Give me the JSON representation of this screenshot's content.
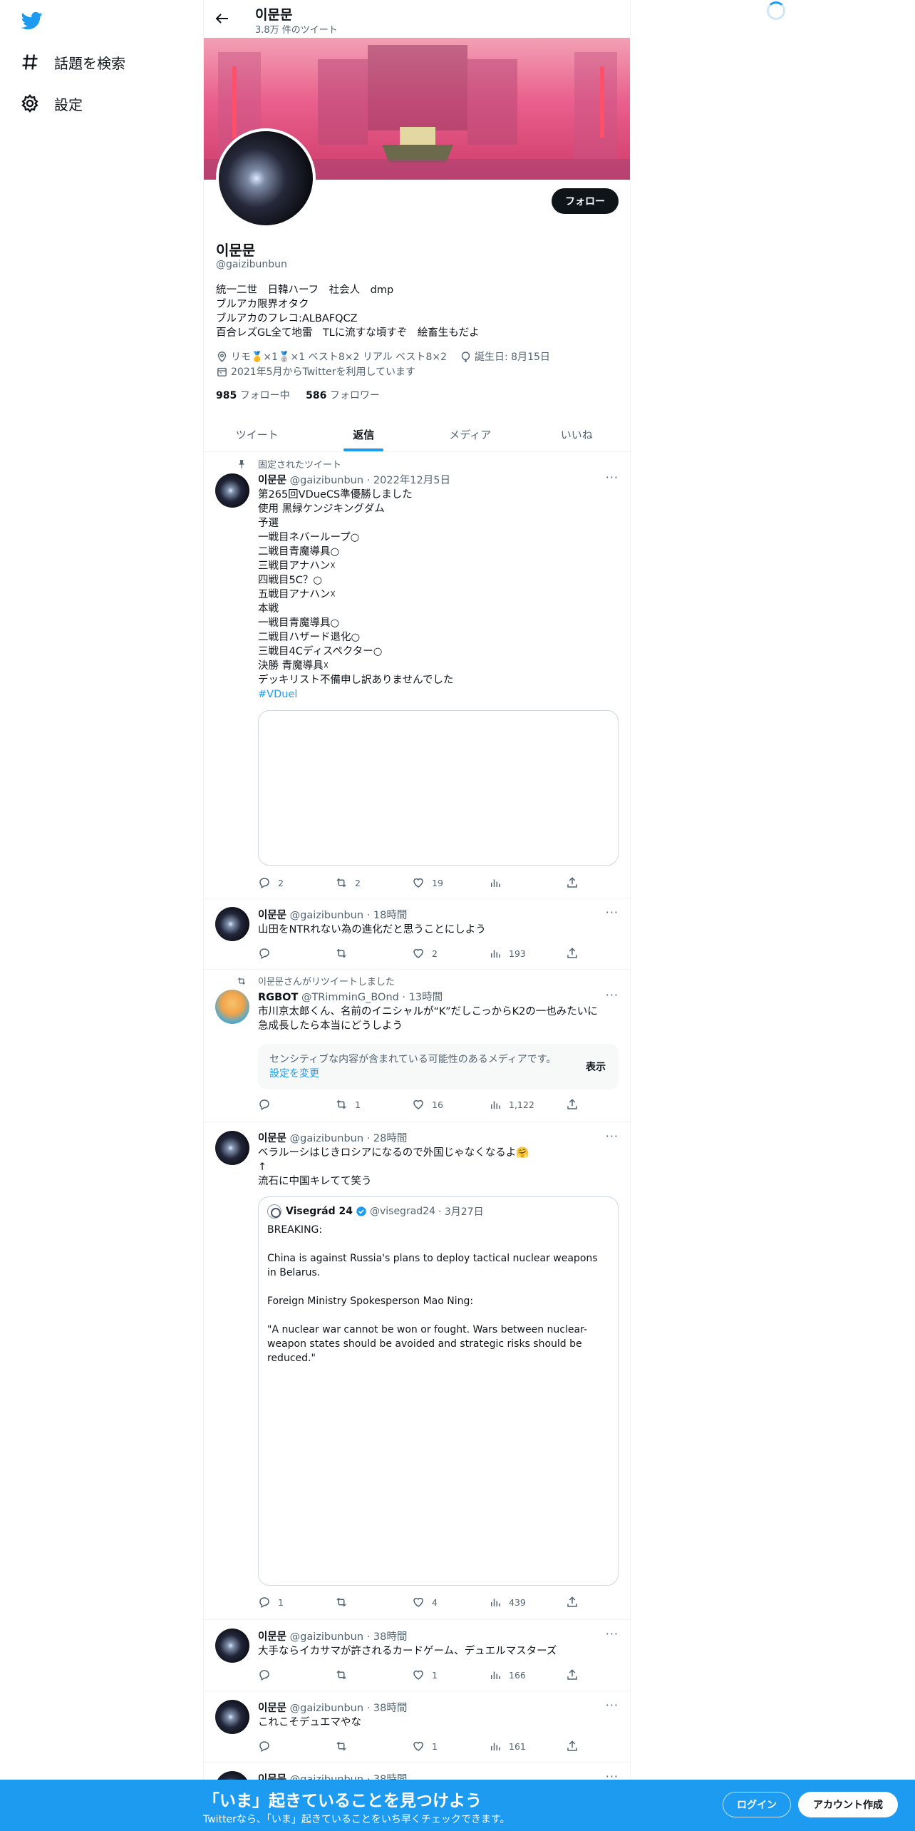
{
  "nav": {
    "explore_label": "話題を検索",
    "settings_label": "設定"
  },
  "header": {
    "name": "이문문",
    "tweet_count": "3.8万 件のツイート"
  },
  "profile": {
    "follow_label": "フォロー",
    "name": "이문문",
    "handle": "@gaizibunbun",
    "bio": [
      "統一二世　日韓ハーフ　社会人　dmp",
      "ブルアカ限界オタク",
      "ブルアカのフレコ:ALBAFQCZ",
      "百合レズGL全て地雷　TLに流すな頃すぞ　絵畜生もだよ"
    ],
    "location": "リモ🥇×1🥈×1 ベスト8×2 リアル ベスト8×2",
    "birthday": "誕生日: 8月15日",
    "joined": "2021年5月からTwitterを利用しています",
    "following_count": "985",
    "following_label": "フォロー中",
    "followers_count": "586",
    "followers_label": "フォロワー"
  },
  "tabs": [
    "ツイート",
    "返信",
    "メディア",
    "いいね"
  ],
  "tweets": {
    "t1": {
      "pinned_label": "固定されたツイート",
      "name": "이문문",
      "handle": "@gaizibunbun",
      "time": "· 2022年12月5日",
      "lines": [
        "第265回VDueCS準優勝しました",
        "使用 黒緑ケンジキングダム",
        "予選",
        "一戦目ネバーループ○",
        "二戦目青魔導具○",
        "三戦目アナハン☓",
        "四戦目5C？○",
        "五戦目アナハン☓",
        "本戦",
        "一戦目青魔導具○",
        "二戦目ハザード退化○",
        "三戦目4Cディスペクター○",
        "決勝 青魔導具☓",
        "デッキリスト不備申し訳ありませんでした"
      ],
      "hashtag": "#VDuel",
      "replies": "2",
      "retweets": "2",
      "likes": "19"
    },
    "t2": {
      "name": "이문문",
      "handle": "@gaizibunbun",
      "time": "· 18時間",
      "text": "山田をNTRれない為の進化だと思うことにしよう",
      "replies": "",
      "retweets": "",
      "likes": "2",
      "views": "193"
    },
    "t3": {
      "social": "이문문さんがリツイートしました",
      "name": "RGBOT",
      "handle": "@TRimminG_BOnd",
      "time": "· 13時間",
      "lines": [
        "市川京太郎くん、名前のイニシャルが“K”だしこっからK2の一也みたいに",
        "急成長したら本当にどうしよう"
      ],
      "sensitive_text": "センシティブな内容が含まれている可能性のあるメディアです。",
      "sensitive_link": "設定を変更",
      "show_label": "表示",
      "replies": "",
      "retweets": "1",
      "likes": "16",
      "views": "1,122"
    },
    "t4": {
      "name": "이문문",
      "handle": "@gaizibunbun",
      "time": "· 28時間",
      "lines": [
        "ベラルーシはじきロシアになるので外国じゃなくなるよ🤗",
        "↑",
        "流石に中国キレてて笑う"
      ],
      "quote": {
        "name": "Visegrád 24",
        "handle": "@visegrad24",
        "time": "· 3月27日",
        "lines": [
          "BREAKING:",
          "",
          "China is against Russia's plans to deploy tactical nuclear weapons in Belarus.",
          "",
          "Foreign Ministry Spokesperson Mao Ning:",
          "",
          "\"A nuclear war cannot be won or fought. Wars between nuclear-weapon states should be avoided and strategic risks should be reduced.\""
        ]
      },
      "replies": "1",
      "retweets": "",
      "likes": "4",
      "views": "439"
    },
    "t5": {
      "name": "이문문",
      "handle": "@gaizibunbun",
      "time": "· 38時間",
      "text": "大手ならイカサマが許されるカードゲーム、デュエルマスターズ",
      "replies": "",
      "retweets": "",
      "likes": "1",
      "views": "166"
    },
    "t6": {
      "name": "이문문",
      "handle": "@gaizibunbun",
      "time": "· 38時間",
      "text": "これこそデュエマやな",
      "replies": "",
      "retweets": "",
      "likes": "1",
      "views": "161"
    },
    "t7": {
      "name": "이문문",
      "handle": "@gaizibunbun",
      "time": "· 38時間"
    }
  },
  "bottom_bar": {
    "title": "「いま」起きていることを見つけよう",
    "subtitle": "Twitterなら、「いま」起きていることをいち早くチェックできます。",
    "login_label": "ログイン",
    "signup_label": "アカウント作成"
  },
  "colors": {
    "accent": "#1d9bf0",
    "text": "#0f1419",
    "muted": "#536471",
    "banner": "#e95f8d"
  }
}
